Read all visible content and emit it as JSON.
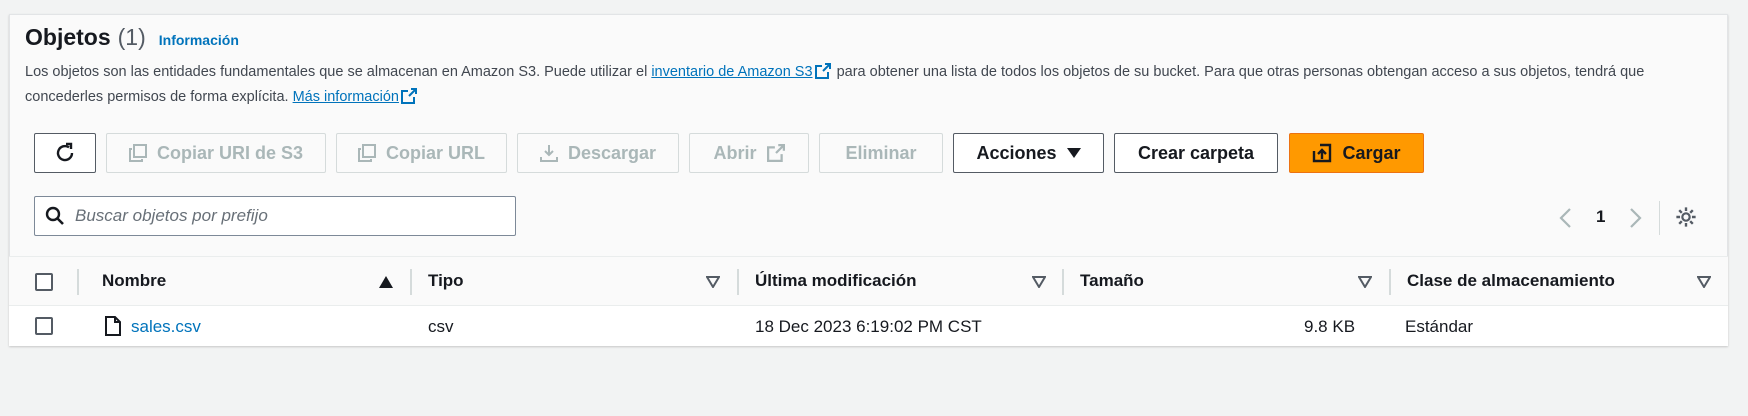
{
  "header": {
    "title": "Objetos",
    "count": "(1)",
    "info_link": "Información"
  },
  "description": {
    "part1": "Los objetos son las entidades fundamentales que se almacenan en Amazon S3. Puede utilizar el",
    "inventory_link": "inventario de Amazon S3",
    "part2": "para obtener una lista de todos los objetos de su bucket. Para que otras personas obtengan acceso a sus objetos, tendrá",
    "part3": "que concederles permisos de forma explícita.",
    "more_link": "Más información"
  },
  "toolbar": {
    "refresh_icon": "refresh-icon",
    "copy_s3_uri": "Copiar URI de S3",
    "copy_url": "Copiar URL",
    "download": "Descargar",
    "open": "Abrir",
    "delete": "Eliminar",
    "actions": "Acciones",
    "create_folder": "Crear carpeta",
    "upload": "Cargar"
  },
  "search": {
    "placeholder": "Buscar objetos por prefijo",
    "value": ""
  },
  "pagination": {
    "current_page": "1"
  },
  "table": {
    "columns": [
      "Nombre",
      "Tipo",
      "Última modificación",
      "Tamaño",
      "Clase de almacenamiento"
    ],
    "rows": [
      {
        "name": "sales.csv",
        "type": "csv",
        "last_modified": "18 Dec 2023 6:19:02 PM CST",
        "size": "9.8 KB",
        "storage_class": "Estándar"
      }
    ]
  },
  "colors": {
    "link": "#0073bb",
    "primary": "#ff9900",
    "disabled_text": "#aab7b8",
    "text": "#16191f"
  }
}
